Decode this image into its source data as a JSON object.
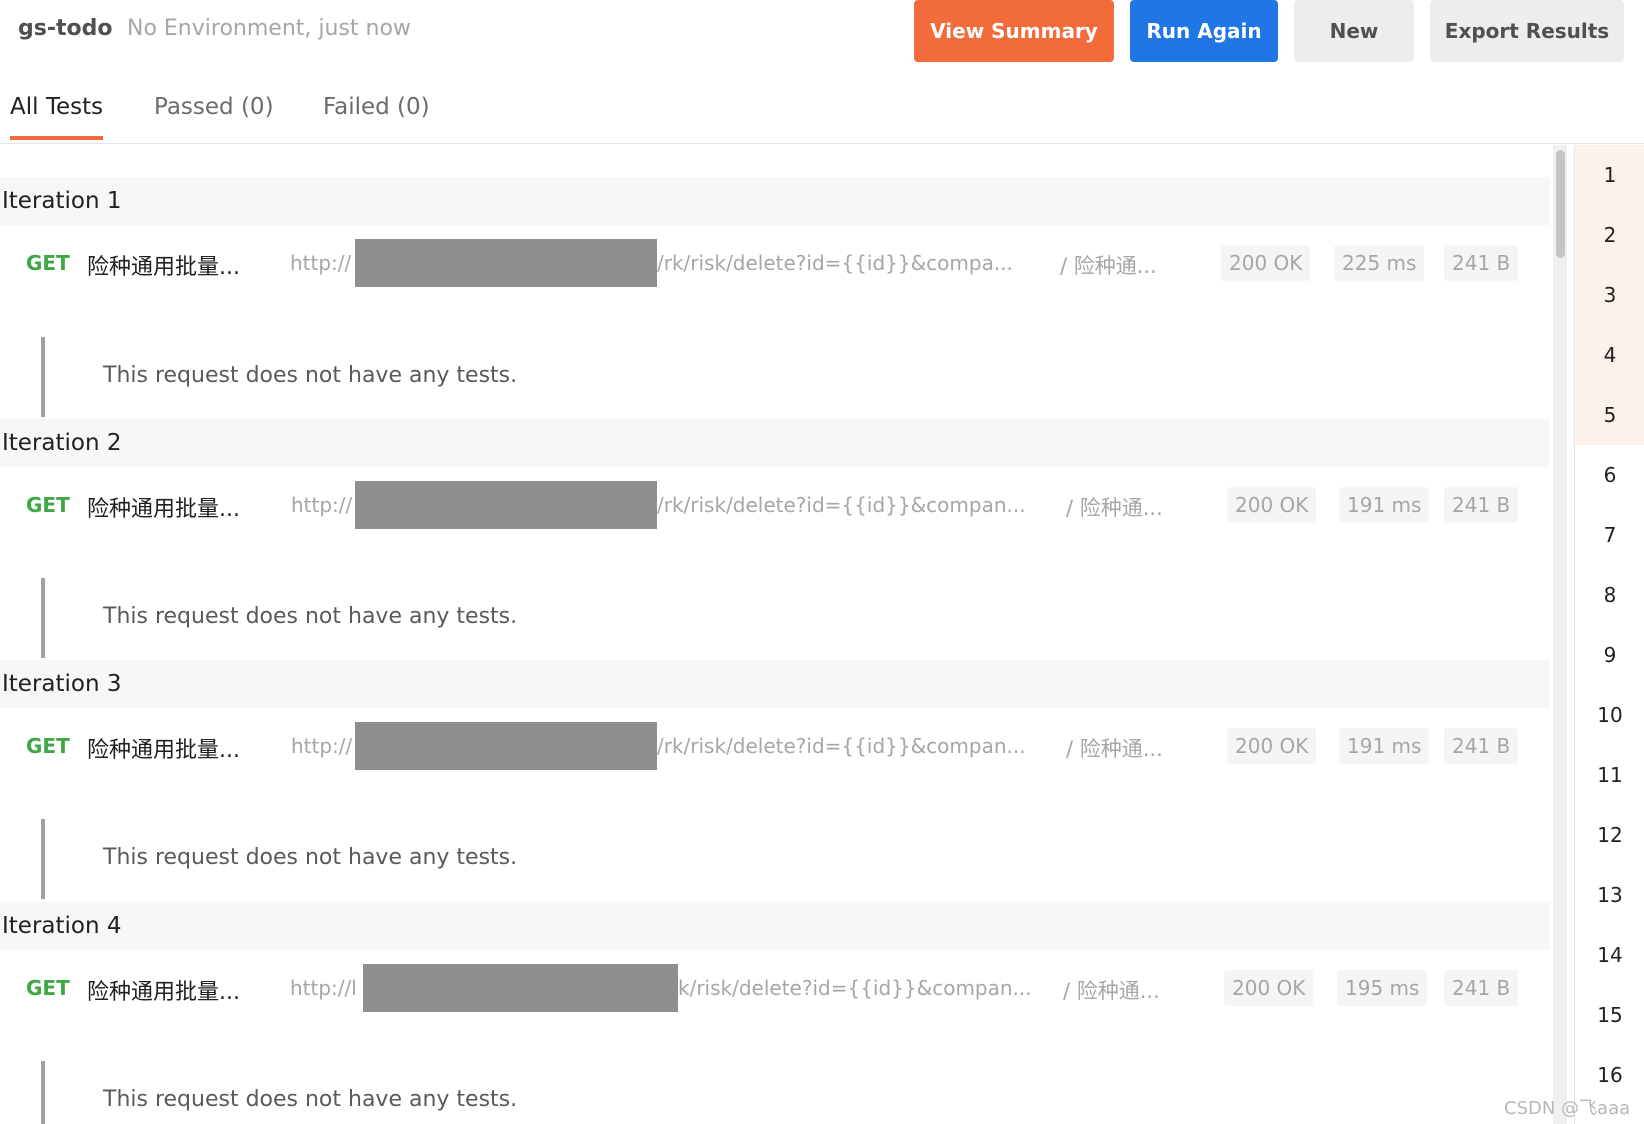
{
  "header": {
    "collection": "gs-todo",
    "meta": "No Environment, just now",
    "buttons": {
      "view_summary": "View Summary",
      "run_again": "Run Again",
      "new": "New",
      "export": "Export Results"
    }
  },
  "tabs": {
    "all": "All Tests",
    "passed": "Passed (0)",
    "failed": "Failed (0)"
  },
  "iterations": [
    {
      "title": "Iteration 1",
      "method": "GET",
      "name": "险种通用批量...",
      "url_prefix": "http://",
      "url_rest": "/rk/risk/delete?id={{id}}&compa...",
      "folder": "/ 险种通...",
      "status": "200 OK",
      "time": "225 ms",
      "size": "241 B",
      "tests_msg": "This request does not have any tests."
    },
    {
      "title": "Iteration 2",
      "method": "GET",
      "name": "险种通用批量...",
      "url_prefix": "http://",
      "url_rest": "/rk/risk/delete?id={{id}}&compan...",
      "folder": "/ 险种通...",
      "status": "200 OK",
      "time": "191 ms",
      "size": "241 B",
      "tests_msg": "This request does not have any tests."
    },
    {
      "title": "Iteration 3",
      "method": "GET",
      "name": "险种通用批量...",
      "url_prefix": "http://",
      "url_rest": "/rk/risk/delete?id={{id}}&compan...",
      "folder": "/ 险种通...",
      "status": "200 OK",
      "time": "191 ms",
      "size": "241 B",
      "tests_msg": "This request does not have any tests."
    },
    {
      "title": "Iteration 4",
      "method": "GET",
      "name": "险种通用批量...",
      "url_prefix": "http://l",
      "url_rest": "k/risk/delete?id={{id}}&compan...",
      "folder": "/ 险种通...",
      "status": "200 OK",
      "time": "195 ms",
      "size": "241 B",
      "tests_msg": "This request does not have any tests."
    }
  ],
  "iteration_nav": [
    "1",
    "2",
    "3",
    "4",
    "5",
    "6",
    "7",
    "8",
    "9",
    "10",
    "11",
    "12",
    "13",
    "14",
    "15",
    "16"
  ],
  "watermark": "CSDN @飞aaa",
  "colors": {
    "accent_orange": "#f26b3a",
    "primary_blue": "#2176e6",
    "method_get": "#3fa845"
  }
}
